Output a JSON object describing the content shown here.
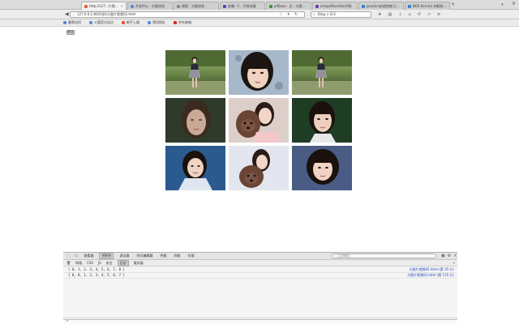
{
  "tabs": [
    {
      "label": "http://127...片视频02.html",
      "color": "#e25a3a",
      "active": true
    },
    {
      "label": "开发中心 - 大图浏览",
      "color": "#5b8ed6",
      "active": false
    },
    {
      "label": "搜索 - 大图浏览",
      "color": "#888888",
      "active": false
    },
    {
      "label": "前端 - F... 开发技能",
      "color": "#6a3fb5",
      "active": false
    },
    {
      "label": "jeffjson - 无 - 大图浏览",
      "color": "#2f9b3f",
      "active": false
    },
    {
      "label": "arrayeffunction代码",
      "color": "#6a3fb5",
      "active": false
    },
    {
      "label": "JavaScript进阶练习...",
      "color": "#3d7fd1",
      "active": false
    },
    {
      "label": "BOS Service 的相关技能",
      "color": "#3d7fd1",
      "active": false
    }
  ],
  "navbar": {
    "back": "◀",
    "forward": "▶",
    "url": "127.0.0.1:8020/JS/大图片视频02.html",
    "search_placeholder": "Bing > Q.S",
    "reload": "↻",
    "home": "⌂"
  },
  "bookmarks": [
    {
      "label": "最常访问",
      "color": "#5b8ed6"
    },
    {
      "label": "火狐官方站点",
      "color": "#5b8ed6"
    },
    {
      "label": "新手上路",
      "color": "#e25a3a"
    },
    {
      "label": "常用网址",
      "color": "#5b8ed6"
    },
    {
      "label": "京东商城",
      "color": "#d42a2a"
    }
  ],
  "page": {
    "button_label": "播放"
  },
  "devtools": {
    "tabs": [
      "查看器",
      "控制台",
      "调试器",
      "样式编辑器",
      "性能",
      "网络",
      "存储"
    ],
    "active_tab_index": 1,
    "filter_placeholder": "过滤输出",
    "subtabs": [
      "网络",
      "CSS",
      "JS",
      "安全",
      "日志",
      "服务器"
    ],
    "active_subtab_index": 4,
    "logs": [
      {
        "text": "[ 0, 1, 2, 3, 4, 5, 6, 7, 8 ]",
        "source": "大图片视频02.html (第 35 行)"
      },
      {
        "text": "[ 8, 0, 1, 2, 3, 4, 5, 6, 7 ]",
        "source": "大图片视频02.html (第 135 行)"
      }
    ]
  }
}
